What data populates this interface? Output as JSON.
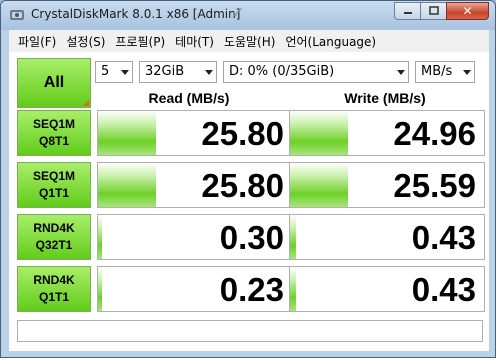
{
  "window": {
    "title": "CrystalDiskMark 8.0.1 x86 [Admin]",
    "icon": "disk-icon"
  },
  "menu": [
    {
      "label": "파일(F)"
    },
    {
      "label": "설정(S)"
    },
    {
      "label": "프로필(P)"
    },
    {
      "label": "테마(T)"
    },
    {
      "label": "도움말(H)"
    },
    {
      "label": "언어(Language)"
    }
  ],
  "controls": {
    "all_label": "All",
    "count": "5",
    "size": "32GiB",
    "drive": "D: 0% (0/35GiB)",
    "unit": "MB/s"
  },
  "headers": {
    "read": "Read (MB/s)",
    "write": "Write (MB/s)"
  },
  "rows": [
    {
      "line1": "SEQ1M",
      "line2": "Q8T1",
      "read": "25.80",
      "write": "24.96",
      "read_fill": 0.3,
      "write_fill": 0.3
    },
    {
      "line1": "SEQ1M",
      "line2": "Q1T1",
      "read": "25.80",
      "write": "25.59",
      "read_fill": 0.3,
      "write_fill": 0.3
    },
    {
      "line1": "RND4K",
      "line2": "Q32T1",
      "read": "0.30",
      "write": "0.43",
      "read_fill": 0.02,
      "write_fill": 0.03
    },
    {
      "line1": "RND4K",
      "line2": "Q1T1",
      "read": "0.23",
      "write": "0.43",
      "read_fill": 0.02,
      "write_fill": 0.03
    }
  ],
  "comment": "",
  "colors": {
    "accent_green": "#62cc1a",
    "title_blue": "#a9c3df",
    "close_red": "#c7462f"
  }
}
